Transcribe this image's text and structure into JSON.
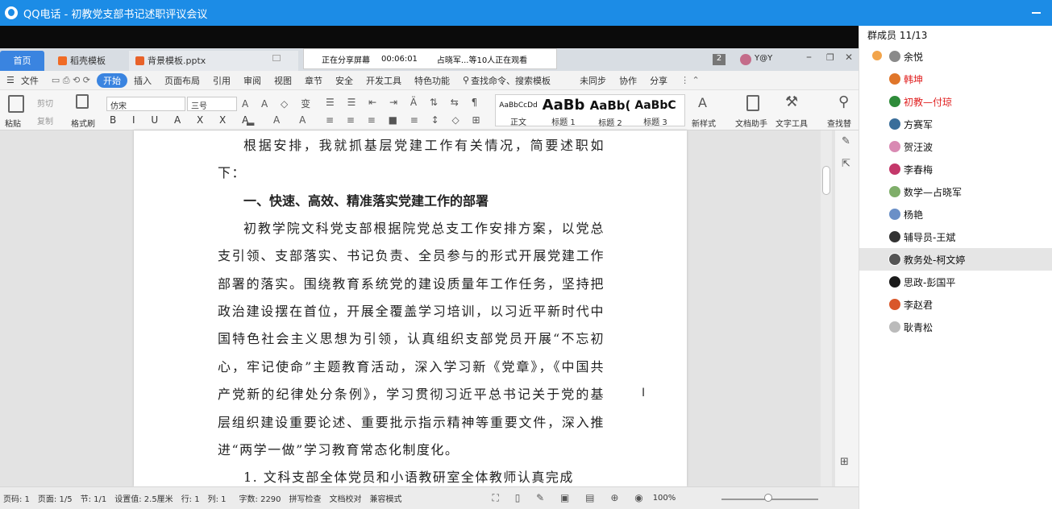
{
  "window": {
    "title": "QQ电话 - 初教党支部书记述职评议会议"
  },
  "share_bar": {
    "status": "正在分享屏幕",
    "timer": "00:06:01",
    "viewers": "占晓军...等10人正在观看"
  },
  "wps": {
    "tabs": [
      {
        "label": "首页",
        "icon": "home-tab-icon"
      },
      {
        "label": "稻壳模板",
        "icon": "docer-icon",
        "color": "#f06b25"
      },
      {
        "label": "背景模板.pptx",
        "icon": "pptx-file-icon",
        "color": "#e8622a"
      }
    ],
    "tab_count": "2",
    "user": "Y@Y",
    "menu": [
      "文件",
      "开始",
      "插入",
      "页面布局",
      "引用",
      "审阅",
      "视图",
      "章节",
      "安全",
      "开发工具",
      "特色功能"
    ],
    "search_placeholder": "查找命令、搜索模板",
    "sync": "未同步",
    "collab": "协作",
    "share": "分享",
    "ribbon": {
      "paste": "粘贴",
      "cut": "剪切",
      "copy": "复制",
      "format_painter": "格式刷",
      "font_name": "仿宋",
      "font_size": "三号",
      "styles": [
        {
          "preview": "AaBbCcDd",
          "label": "正文"
        },
        {
          "preview": "AaBb",
          "label": "标题 1"
        },
        {
          "preview": "AaBb(",
          "label": "标题 2"
        },
        {
          "preview": "AaBbC",
          "label": "标题 3"
        }
      ],
      "new_style": "新样式",
      "doc_assistant": "文档助手",
      "text_tools": "文字工具",
      "find_replace": "查找替"
    },
    "document": {
      "paragraphs": [
        {
          "type": "p",
          "text": "根据安排，我就抓基层党建工作有关情况，简要述职如下："
        },
        {
          "type": "h",
          "text": "一、快速、高效、精准落实党建工作的部署"
        },
        {
          "type": "p",
          "text": "初教学院文科党支部根据院党总支工作安排方案，以党总支引领、支部落实、书记负责、全员参与的形式开展党建工作部署的落实。围绕教育系统党的建设质量年工作任务，坚持把政治建设摆在首位，开展全覆盖学习培训，以习近平新时代中国特色社会主义思想为引领，认真组织支部党员开展“不忘初心，牢记使命”主题教育活动，深入学习新《党章》，《中国共产党新的纪律处分条例》，学习贯彻习近平总书记关于党的基层组织建设重要论述、重要批示指示精神等重要文件，深入推进“两学一做”学习教育常态化制度化。"
        },
        {
          "type": "p",
          "text": "1. 文科支部全体党员和小语教研室全体教师认真完成"
        }
      ]
    },
    "status": {
      "page_no": "页码: 1",
      "pages": "页面: 1/5",
      "section": "节: 1/1",
      "setting": "设置值: 2.5厘米",
      "row": "行: 1",
      "col": "列: 1",
      "words": "字数: 2290",
      "spell": "拼写检查",
      "proof": "文档校对",
      "compat": "兼容模式",
      "zoom": "100%"
    }
  },
  "members_panel": {
    "title": "群成员 11/13",
    "members": [
      {
        "name": "余悦",
        "color": "#111111",
        "avatar": "#8a8a8a",
        "host": true
      },
      {
        "name": "韩坤",
        "color": "#e02020",
        "avatar": "#e0762a"
      },
      {
        "name": "初教—付琼",
        "color": "#e02020",
        "avatar": "#2e8b3a"
      },
      {
        "name": "方赛军",
        "color": "#111111",
        "avatar": "#3a6e9a"
      },
      {
        "name": "贺汪波",
        "color": "#111111",
        "avatar": "#d98ab3"
      },
      {
        "name": "李春梅",
        "color": "#111111",
        "avatar": "#c4386a"
      },
      {
        "name": "数学—占晓军",
        "color": "#111111",
        "avatar": "#7fae6a"
      },
      {
        "name": "杨艳",
        "color": "#111111",
        "avatar": "#6a8fc7"
      },
      {
        "name": "辅导员-王斌",
        "color": "#111111",
        "avatar": "#333333"
      },
      {
        "name": "教务处-柯文婷",
        "color": "#111111",
        "avatar": "#555555",
        "selected": true
      },
      {
        "name": "思政-彭国平",
        "color": "#111111",
        "avatar": "#1a1a1a"
      },
      {
        "name": "李赵君",
        "color": "#111111",
        "avatar": "#d9572a"
      },
      {
        "name": "耿青松",
        "color": "#111111",
        "avatar": "#bbbbbb"
      }
    ]
  }
}
